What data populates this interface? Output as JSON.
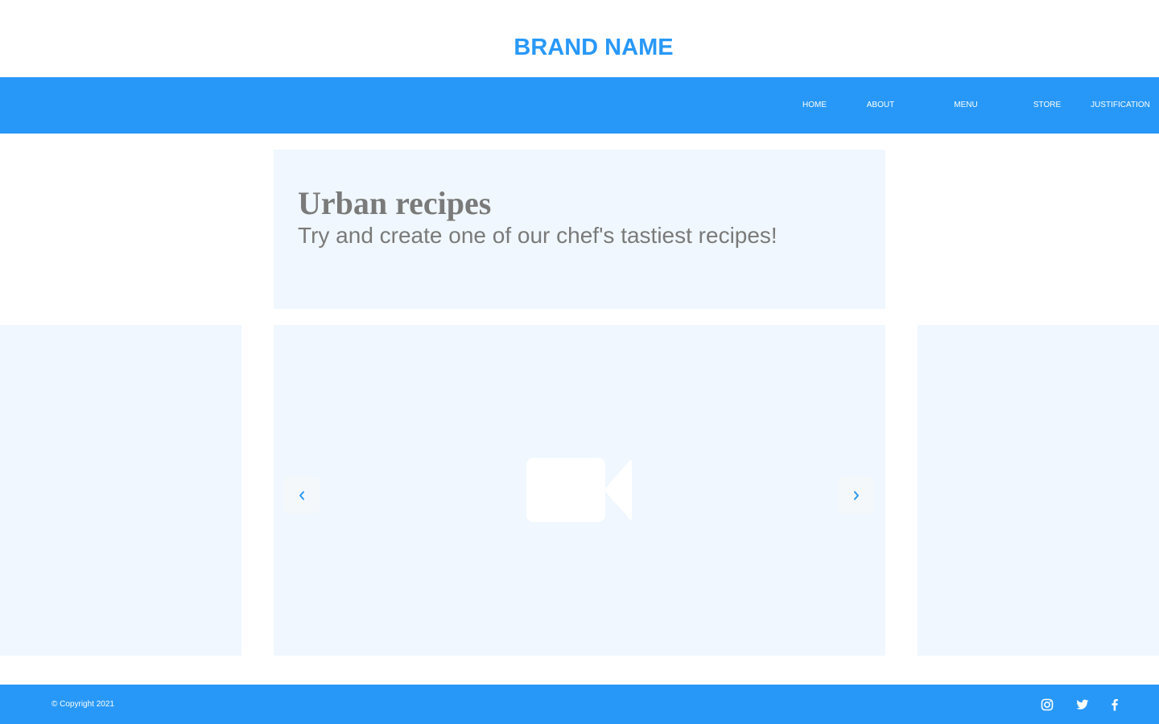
{
  "brand": {
    "name": "BRAND NAME"
  },
  "nav": {
    "items": [
      {
        "label": "HOME"
      },
      {
        "label": "ABOUT"
      },
      {
        "label": "MENU"
      },
      {
        "label": "STORE"
      },
      {
        "label": "JUSTIFICATION"
      }
    ]
  },
  "intro": {
    "title": "Urban recipes",
    "subtitle": "Try and create one of our chef's tastiest recipes!"
  },
  "carousel": {
    "media_icon": "video-camera-icon",
    "prev_icon": "chevron-left-icon",
    "next_icon": "chevron-right-icon"
  },
  "footer": {
    "copyright": "© Copyright 2021",
    "social": [
      {
        "icon": "instagram-icon"
      },
      {
        "icon": "twitter-icon"
      },
      {
        "icon": "facebook-icon"
      }
    ]
  },
  "colors": {
    "brand": "#2898f8",
    "panel": "#f0f7fe",
    "text_muted": "#7a7a7a",
    "background": "#ffffff"
  }
}
